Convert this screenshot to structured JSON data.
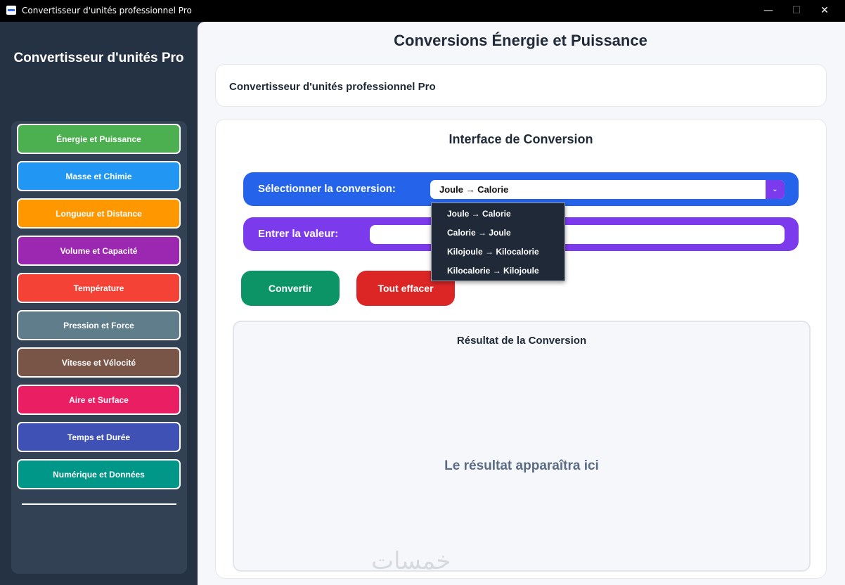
{
  "window": {
    "title": "Convertisseur d'unités professionnel Pro",
    "min": "—",
    "max": "☐",
    "close": "✕"
  },
  "sidebar": {
    "title": "Convertisseur d'unités Pro",
    "items": [
      {
        "label": "Énergie et Puissance",
        "color": "#4caf50"
      },
      {
        "label": "Masse et Chimie",
        "color": "#2196f3"
      },
      {
        "label": "Longueur et Distance",
        "color": "#ff9800"
      },
      {
        "label": "Volume et Capacité",
        "color": "#9c27b0"
      },
      {
        "label": "Température",
        "color": "#f44336"
      },
      {
        "label": "Pression et Force",
        "color": "#607d8b"
      },
      {
        "label": "Vitesse et Vélocité",
        "color": "#795548"
      },
      {
        "label": "Aire et Surface",
        "color": "#e91e63"
      },
      {
        "label": "Temps et Durée",
        "color": "#3f51b5"
      },
      {
        "label": "Numérique et Données",
        "color": "#009688"
      }
    ]
  },
  "main": {
    "title": "Conversions Énergie et Puissance",
    "header_card": "Convertisseur d'unités professionnel Pro",
    "interface_title": "Interface de Conversion",
    "select_label": "Sélectionner la conversion:",
    "select_value": "Joule → Calorie",
    "input_label": "Entrer la valeur:",
    "input_value": "",
    "convert_button": "Convertir",
    "clear_button": "Tout effacer",
    "result_title": "Résultat de la Conversion",
    "result_placeholder": "Le résultat apparaîtra ici"
  },
  "dropdown": {
    "options": [
      "Joule → Calorie",
      "Calorie → Joule",
      "Kilojoule → Kilocalorie",
      "Kilocalorie → Kilojoule"
    ]
  },
  "watermark": "خمسات"
}
